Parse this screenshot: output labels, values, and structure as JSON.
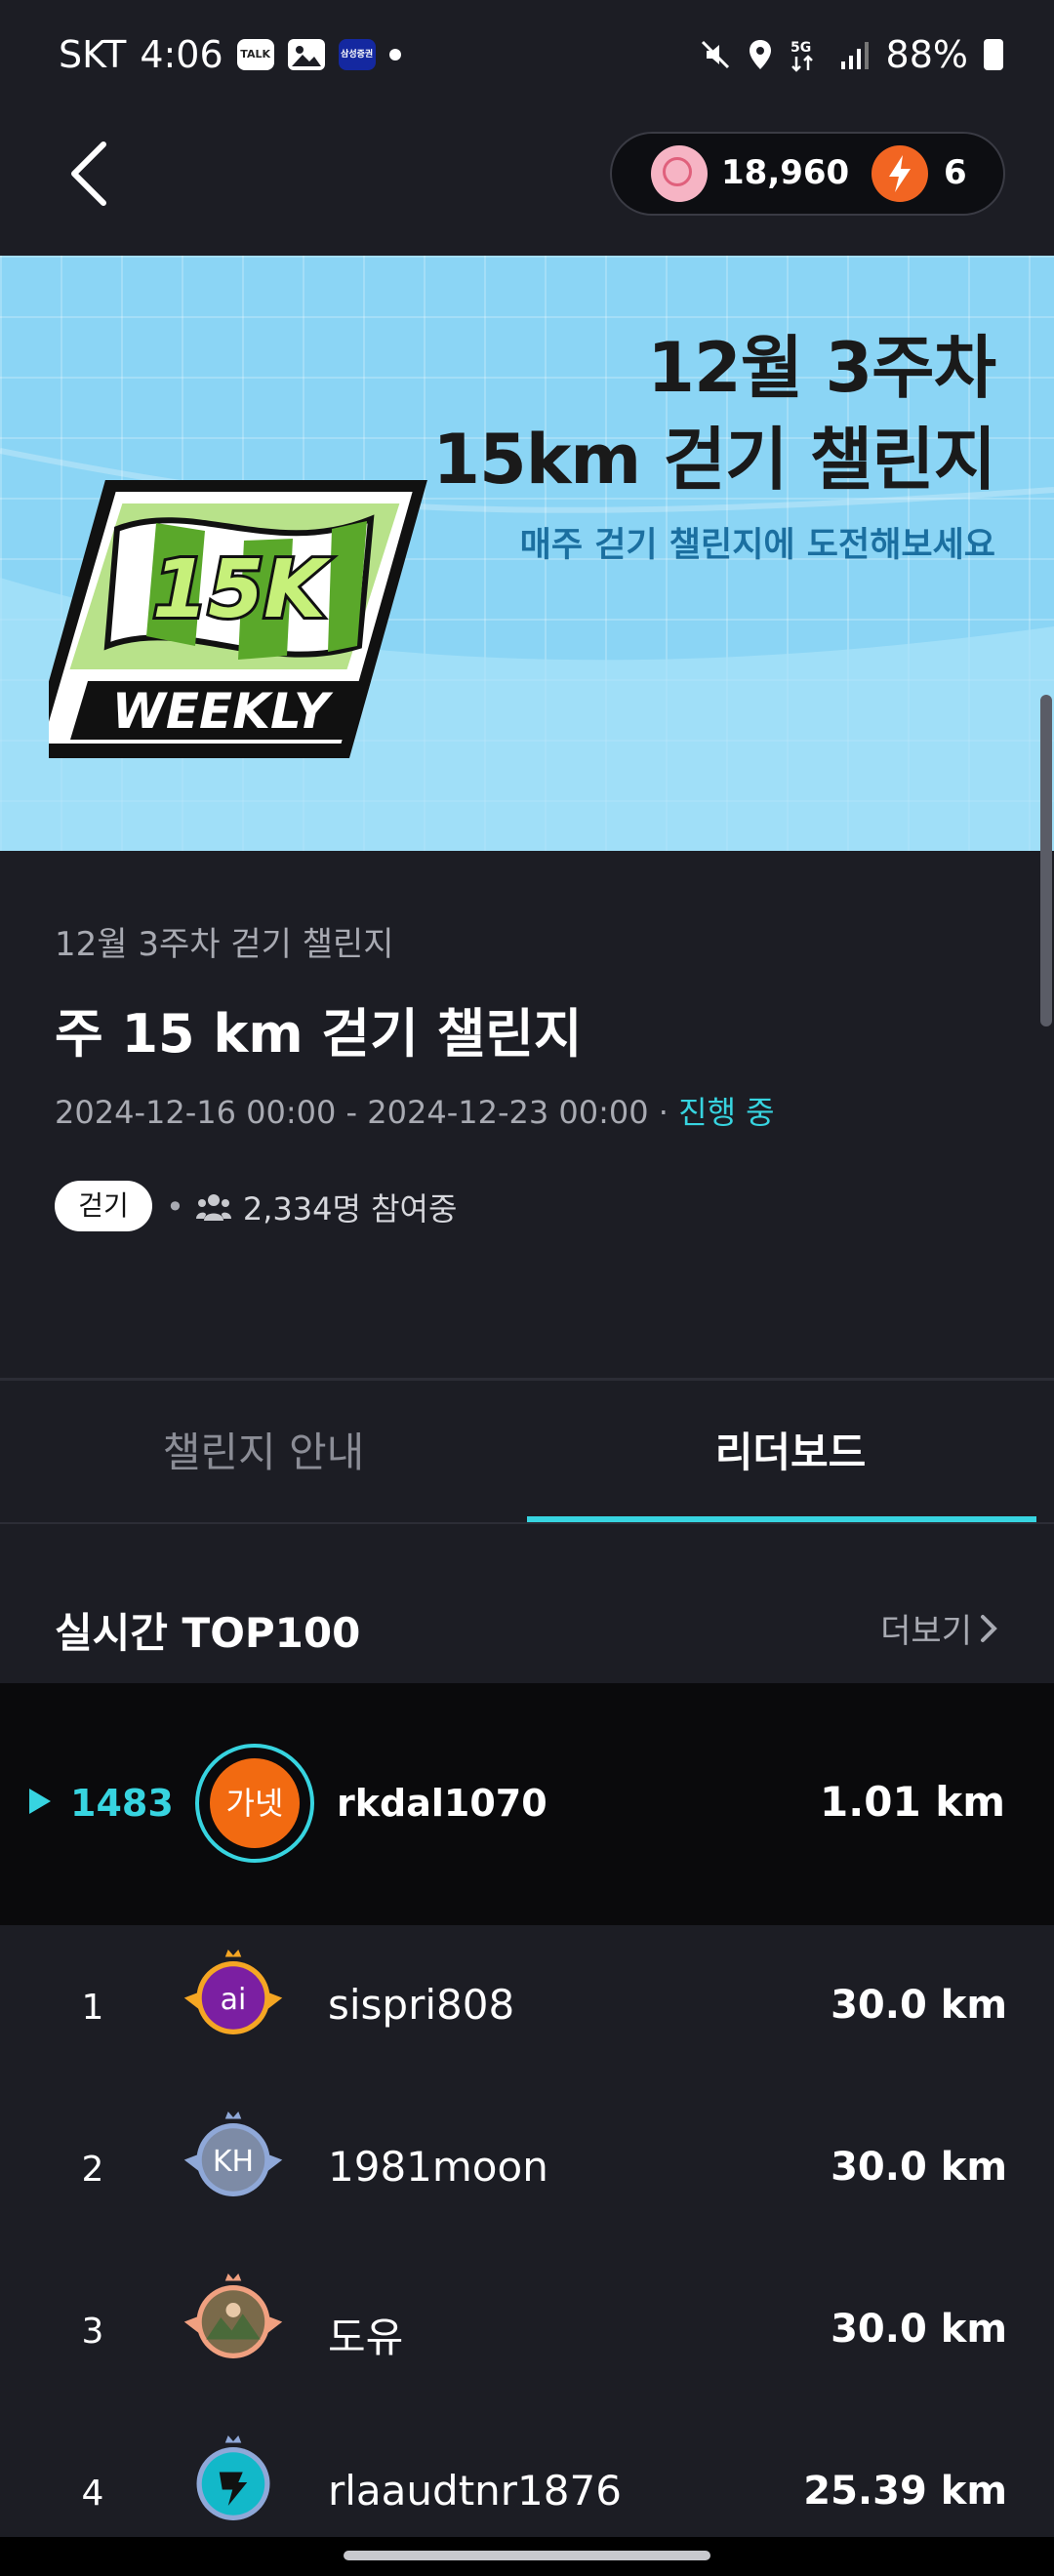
{
  "status_bar": {
    "carrier": "SKT",
    "time": "4:06",
    "notif_icons": [
      "TALK",
      "gallery-icon",
      "삼성증권"
    ],
    "battery": "88%"
  },
  "header": {
    "tik_balance": "18,960",
    "bolt_count": "6"
  },
  "banner": {
    "title_line1": "12월 3주차",
    "title_line2": "15km 걷기 챌린지",
    "subtitle": "매주 걷기 챌린지에 도전해보세요",
    "badge_main": "15K",
    "badge_sub": "WEEKLY"
  },
  "challenge": {
    "subtitle": "12월 3주차 걷기 챌린지",
    "title": "주 15 km 걷기 챌린지",
    "period": "2024-12-16 00:00 - 2024-12-23 00:00 · ",
    "status": "진행 중",
    "tag": "걷기",
    "participants": "2,334명 참여중"
  },
  "tabs": [
    {
      "label": "챌린지 안내",
      "active": false
    },
    {
      "label": "리더보드",
      "active": true
    }
  ],
  "leaderboard": {
    "title": "실시간 TOP100",
    "more_label": "더보기",
    "me": {
      "rank": "1483",
      "avatar_text": "가넷",
      "name": "rkdal1070",
      "distance": "1.01 km"
    },
    "rows": [
      {
        "rank": "1",
        "avatar_text": "ai",
        "name": "sispri808",
        "distance": "30.0 km",
        "medal": "#f5a623",
        "avatar_bg": "#7b1fa2"
      },
      {
        "rank": "2",
        "avatar_text": "KH",
        "name": "1981moon",
        "distance": "30.0 km",
        "medal": "#8fa8d8",
        "avatar_bg": "#7d8ba6"
      },
      {
        "rank": "3",
        "avatar_text": "",
        "name": "도유",
        "distance": "30.0 km",
        "medal": "#f0a080",
        "avatar_bg": "#7a6a4a"
      },
      {
        "rank": "4",
        "avatar_text": "",
        "name": "rlaaudtnr1876",
        "distance": "25.39 km",
        "medal": "#8fa8d8",
        "avatar_bg": "#12b8c9"
      }
    ]
  },
  "colors": {
    "accent": "#37d4e0",
    "background": "#1c1d24",
    "banner": "#8bd5f5",
    "avatar_orange": "#f26a11"
  }
}
